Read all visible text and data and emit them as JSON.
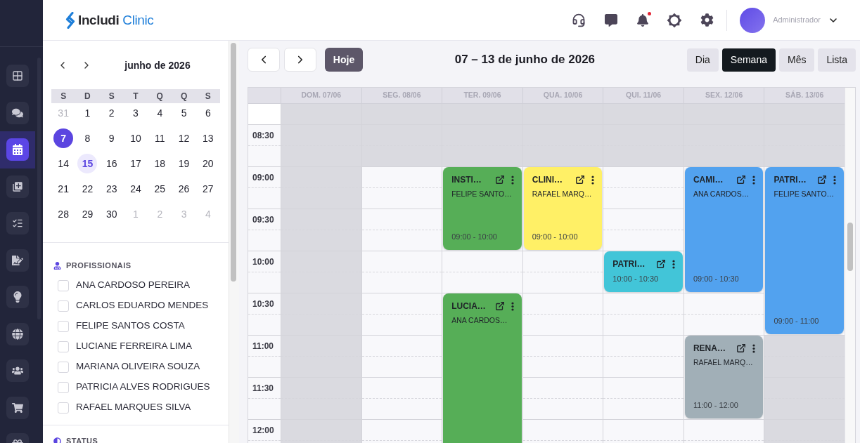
{
  "nav": [
    {
      "selected": false
    },
    {
      "selected": false
    },
    {
      "selected": true
    },
    {
      "selected": false
    },
    {
      "selected": false
    },
    {
      "selected": false
    },
    {
      "selected": false
    },
    {
      "selected": false
    },
    {
      "selected": false
    },
    {
      "selected": false
    },
    {
      "selected": false
    }
  ],
  "header": {
    "logo": {
      "name": "Includi",
      "product": "Clinic"
    },
    "notifications": {
      "unread": true
    },
    "user": {
      "name": "Administrador"
    }
  },
  "mini_calendar": {
    "month": "junho de 2026",
    "weekdays": [
      "S",
      "D",
      "S",
      "T",
      "Q",
      "Q",
      "S"
    ],
    "weeks": [
      [
        {
          "label": "31",
          "outside": true,
          "selected": false,
          "today": false
        },
        {
          "label": "1",
          "outside": false,
          "selected": false,
          "today": false
        },
        {
          "label": "2",
          "outside": false,
          "selected": false,
          "today": false
        },
        {
          "label": "3",
          "outside": false,
          "selected": false,
          "today": false
        },
        {
          "label": "4",
          "outside": false,
          "selected": false,
          "today": false
        },
        {
          "label": "5",
          "outside": false,
          "selected": false,
          "today": false
        },
        {
          "label": "6",
          "outside": false,
          "selected": false,
          "today": false
        }
      ],
      [
        {
          "label": "7",
          "outside": false,
          "selected": true,
          "today": false
        },
        {
          "label": "8",
          "outside": false,
          "selected": false,
          "today": false
        },
        {
          "label": "9",
          "outside": false,
          "selected": false,
          "today": false
        },
        {
          "label": "10",
          "outside": false,
          "selected": false,
          "today": false
        },
        {
          "label": "11",
          "outside": false,
          "selected": false,
          "today": false
        },
        {
          "label": "12",
          "outside": false,
          "selected": false,
          "today": false
        },
        {
          "label": "13",
          "outside": false,
          "selected": false,
          "today": false
        }
      ],
      [
        {
          "label": "14",
          "outside": false,
          "selected": false,
          "today": false
        },
        {
          "label": "15",
          "outside": false,
          "selected": false,
          "today": true
        },
        {
          "label": "16",
          "outside": false,
          "selected": false,
          "today": false
        },
        {
          "label": "17",
          "outside": false,
          "selected": false,
          "today": false
        },
        {
          "label": "18",
          "outside": false,
          "selected": false,
          "today": false
        },
        {
          "label": "19",
          "outside": false,
          "selected": false,
          "today": false
        },
        {
          "label": "20",
          "outside": false,
          "selected": false,
          "today": false
        }
      ],
      [
        {
          "label": "21",
          "outside": false,
          "selected": false,
          "today": false
        },
        {
          "label": "22",
          "outside": false,
          "selected": false,
          "today": false
        },
        {
          "label": "23",
          "outside": false,
          "selected": false,
          "today": false
        },
        {
          "label": "24",
          "outside": false,
          "selected": false,
          "today": false
        },
        {
          "label": "25",
          "outside": false,
          "selected": false,
          "today": false
        },
        {
          "label": "26",
          "outside": false,
          "selected": false,
          "today": false
        },
        {
          "label": "27",
          "outside": false,
          "selected": false,
          "today": false
        }
      ],
      [
        {
          "label": "28",
          "outside": false,
          "selected": false,
          "today": false
        },
        {
          "label": "29",
          "outside": false,
          "selected": false,
          "today": false
        },
        {
          "label": "30",
          "outside": false,
          "selected": false,
          "today": false
        },
        {
          "label": "1",
          "outside": true,
          "selected": false,
          "today": false
        },
        {
          "label": "2",
          "outside": true,
          "selected": false,
          "today": false
        },
        {
          "label": "3",
          "outside": true,
          "selected": false,
          "today": false
        },
        {
          "label": "4",
          "outside": true,
          "selected": false,
          "today": false
        }
      ]
    ]
  },
  "professionals": {
    "title": "PROFISSIONAIS",
    "items": [
      {
        "name": "ANA CARDOSO PEREIRA",
        "checked": false
      },
      {
        "name": "CARLOS EDUARDO MENDES",
        "checked": false
      },
      {
        "name": "FELIPE SANTOS COSTA",
        "checked": false
      },
      {
        "name": "LUCIANE FERREIRA LIMA",
        "checked": false
      },
      {
        "name": "MARIANA OLIVEIRA SOUZA",
        "checked": false
      },
      {
        "name": "PATRICIA ALVES RODRIGUES",
        "checked": false
      },
      {
        "name": "RAFAEL MARQUES SILVA",
        "checked": false
      }
    ]
  },
  "status": {
    "title": "STATUS"
  },
  "toolbar": {
    "today": "Hoje",
    "range": "07 – 13 de junho de 2026",
    "views": [
      {
        "label": "Dia",
        "selected": false
      },
      {
        "label": "Semana",
        "selected": true
      },
      {
        "label": "Mês",
        "selected": false
      },
      {
        "label": "Lista",
        "selected": false
      }
    ]
  },
  "calendar": {
    "times": [
      "08:30",
      "09:00",
      "09:30",
      "10:00",
      "10:30",
      "11:00",
      "11:30",
      "12:00"
    ],
    "days": [
      {
        "label": "DOM. 07/06",
        "slots": [
          {
            "off": true
          },
          {
            "off": true
          },
          {
            "off": true
          },
          {
            "off": true
          },
          {
            "off": true
          },
          {
            "off": true
          },
          {
            "off": true
          },
          {
            "off": true
          },
          {
            "off": true
          }
        ]
      },
      {
        "label": "SEG. 08/06",
        "slots": [
          {
            "off": true
          },
          {
            "off": true
          },
          {
            "off": false
          },
          {
            "off": false
          },
          {
            "off": false
          },
          {
            "off": false
          },
          {
            "off": false
          },
          {
            "off": false
          },
          {
            "off": false
          }
        ]
      },
      {
        "label": "TER. 09/06",
        "slots": [
          {
            "off": true
          },
          {
            "off": true
          },
          {
            "events": [
              {
                "title": "INSTI…",
                "professional": "FELIPE SANTO…",
                "time": "09:00 - 10:00",
                "color": "#56ae57"
              }
            ]
          },
          {
            "off": false
          },
          {
            "events": [
              {
                "title": "LUCIA…",
                "professional": "ANA CARDOS…",
                "color": "#56ae57"
              }
            ]
          }
        ]
      },
      {
        "label": "QUA. 10/06",
        "slots": [
          {
            "off": true
          },
          {
            "off": true
          },
          {
            "events": [
              {
                "title": "CLINI…",
                "professional": "RAFAEL MARQ…",
                "time": "09:00 - 10:00",
                "color": "#fff066"
              }
            ]
          },
          {
            "off": false
          },
          {
            "off": false
          },
          {
            "off": false
          },
          {
            "off": false
          },
          {
            "off": false
          }
        ]
      },
      {
        "label": "QUI. 11/06",
        "slots": [
          {
            "off": true
          },
          {
            "off": true
          },
          {
            "off": false
          },
          {
            "off": false
          },
          {
            "events": [
              {
                "title": "PATRI…",
                "time": "10:00 - 10:30",
                "color": "#42c5d8"
              }
            ]
          },
          {
            "off": false
          },
          {
            "off": false
          },
          {
            "off": false
          },
          {
            "off": false
          }
        ]
      },
      {
        "label": "SEX. 12/06",
        "slots": [
          {
            "off": true
          },
          {
            "off": true
          },
          {
            "events": [
              {
                "title": "CAMI…",
                "professional": "ANA CARDOS…",
                "time": "09:00 - 10:30",
                "color": "#52a2ef"
              }
            ]
          },
          {
            "off": false
          },
          {
            "events": [
              {
                "title": "RENA…",
                "professional": "RAFAEL MARQ…",
                "time": "11:00 - 12:00",
                "color": "#a1afb7"
              }
            ]
          },
          {
            "off": false
          }
        ]
      },
      {
        "label": "SÁB. 13/06",
        "slots": [
          {
            "off": true
          },
          {
            "off": true
          },
          {
            "events": [
              {
                "title": "PATRI…",
                "professional": "FELIPE SANTO…",
                "time": "09:00 - 11:00",
                "color": "#52a2ef"
              }
            ]
          },
          {
            "off": true
          },
          {
            "off": true
          },
          {
            "off": true
          }
        ]
      }
    ]
  }
}
